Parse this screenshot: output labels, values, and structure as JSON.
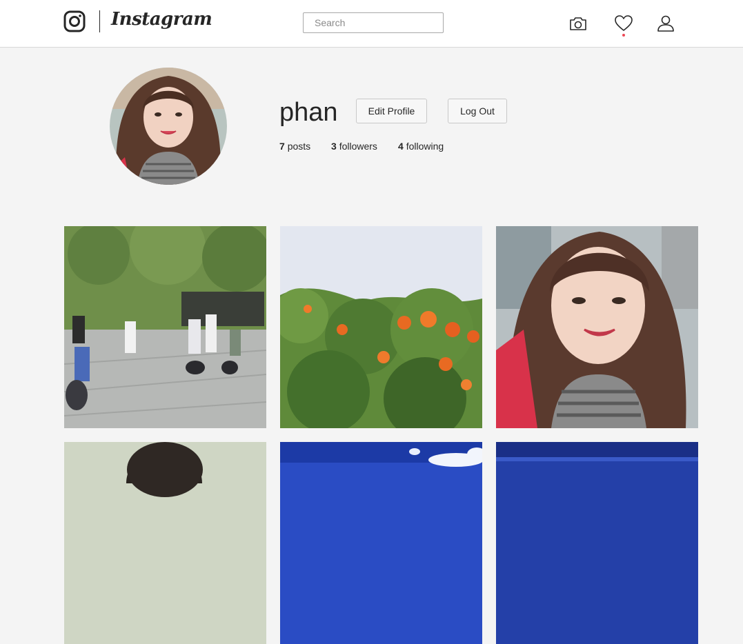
{
  "header": {
    "brand": "Instagram",
    "search": {
      "placeholder": "Search",
      "value": ""
    },
    "icons": [
      "camera-icon",
      "heart-icon",
      "user-icon"
    ],
    "notification_dot_color": "#ed4956"
  },
  "profile": {
    "username": "phan",
    "edit_label": "Edit Profile",
    "logout_label": "Log Out",
    "stats": [
      {
        "count": "7",
        "label": "posts"
      },
      {
        "count": "3",
        "label": "followers"
      },
      {
        "count": "4",
        "label": "following"
      }
    ]
  },
  "posts": [
    {
      "kind": "group-photo"
    },
    {
      "kind": "flowering-tree"
    },
    {
      "kind": "selfie"
    },
    {
      "kind": "portrait-partial"
    },
    {
      "kind": "blue-sky"
    },
    {
      "kind": "blue-sky-dark"
    }
  ],
  "colors": {
    "page_background": "#f4f4f4",
    "topbar_background": "#ffffff",
    "text": "#262626"
  }
}
